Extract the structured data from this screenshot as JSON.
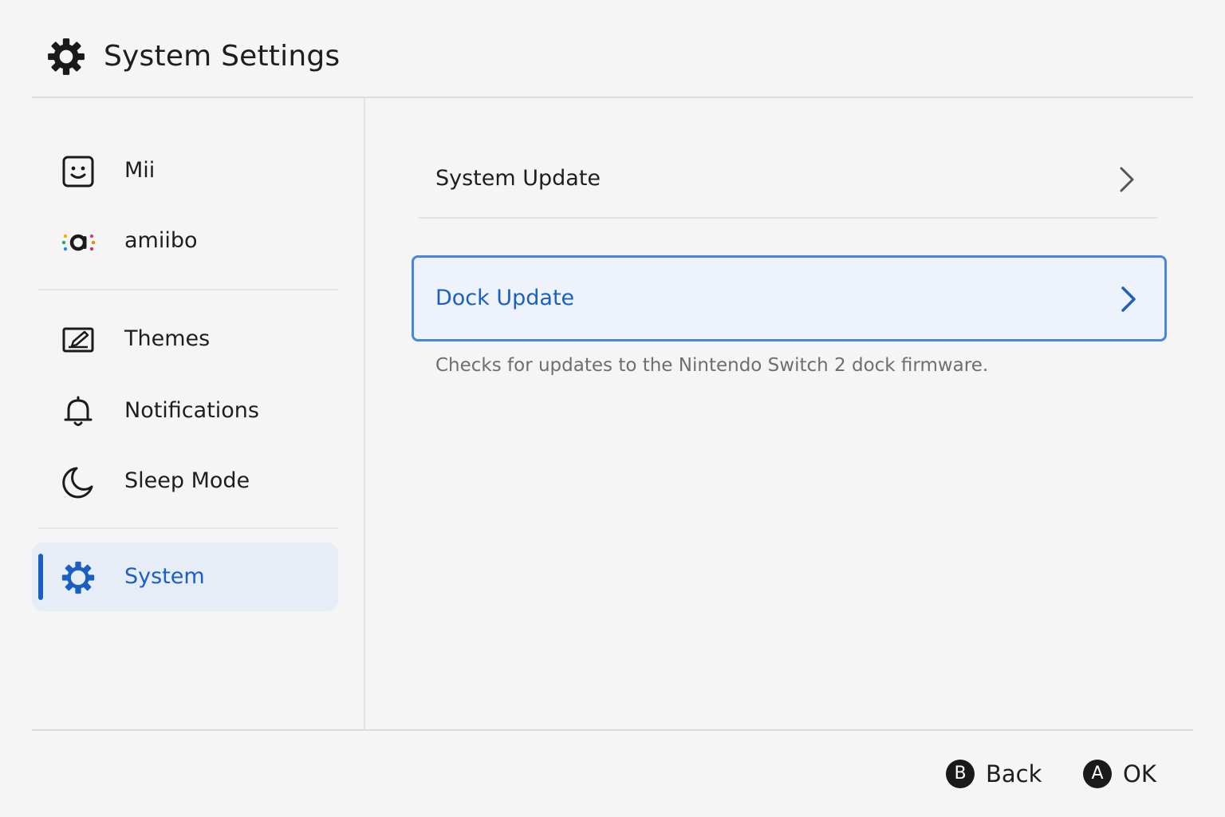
{
  "header": {
    "title": "System Settings",
    "icon": "gear-icon"
  },
  "sidebar": {
    "items": [
      {
        "label": "Mii",
        "icon": "mii-face-icon",
        "selected": false
      },
      {
        "label": "amiibo",
        "icon": "amiibo-icon",
        "selected": false
      },
      {
        "label": "Themes",
        "icon": "themes-icon",
        "selected": false
      },
      {
        "label": "Notifications",
        "icon": "bell-icon",
        "selected": false
      },
      {
        "label": "Sleep Mode",
        "icon": "moon-icon",
        "selected": false
      },
      {
        "label": "System",
        "icon": "gear-icon",
        "selected": true
      }
    ]
  },
  "main": {
    "rows": [
      {
        "label": "System Update",
        "icon": "chevron-right-icon",
        "selected": false
      },
      {
        "label": "Dock Update",
        "icon": "chevron-right-icon",
        "selected": true
      }
    ],
    "description": "Checks for updates to the Nintendo Switch 2 dock firmware."
  },
  "footer": {
    "back": {
      "button": "B",
      "label": "Back"
    },
    "ok": {
      "button": "A",
      "label": "OK"
    }
  },
  "colors": {
    "background": "#f5f5f5",
    "accent": "#1a5fc4",
    "selection_border": "#4a86df",
    "selection_fill": "#eef3fb",
    "sidebar_selection_fill": "#e6edf6",
    "description_text": "#6e6e6e"
  }
}
